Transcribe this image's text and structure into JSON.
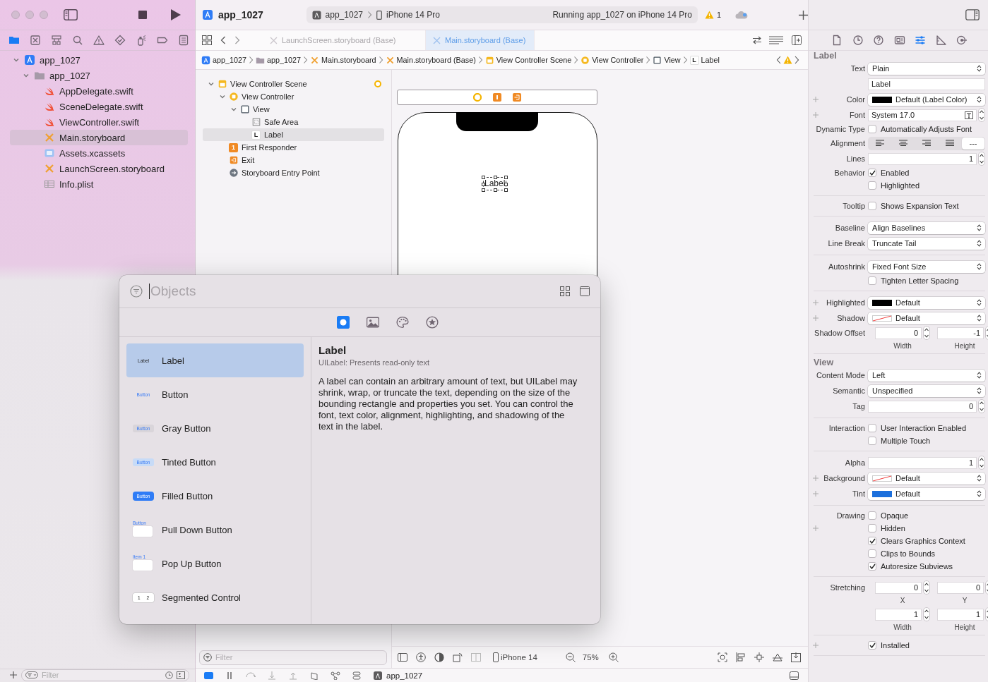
{
  "window": {
    "title": "app_1027"
  },
  "toolbar": {
    "scheme": "app_1027",
    "destination": "iPhone 14 Pro",
    "status": "Running app_1027 on iPhone 14 Pro",
    "warning_count": "1"
  },
  "navigator": {
    "tabs": [
      {
        "kind": "folder",
        "selected": true
      },
      {
        "kind": "source-control",
        "selected": false
      },
      {
        "kind": "hierarchy",
        "selected": false
      },
      {
        "kind": "search",
        "selected": false
      },
      {
        "kind": "warning",
        "selected": false
      },
      {
        "kind": "test",
        "selected": false
      },
      {
        "kind": "debug",
        "selected": false
      },
      {
        "kind": "breakpoint",
        "selected": false
      },
      {
        "kind": "report",
        "selected": false
      }
    ],
    "tree": [
      {
        "label": "app_1027",
        "kind": "project",
        "expanded": true,
        "selected": false,
        "children": [
          {
            "label": "app_1027",
            "kind": "folder",
            "expanded": true,
            "selected": false,
            "children": [
              {
                "label": "AppDelegate.swift",
                "kind": "swift",
                "selected": false
              },
              {
                "label": "SceneDelegate.swift",
                "kind": "swift",
                "selected": false
              },
              {
                "label": "ViewController.swift",
                "kind": "swift",
                "selected": false
              },
              {
                "label": "Main.storyboard",
                "kind": "storyboard",
                "selected": true
              },
              {
                "label": "Assets.xcassets",
                "kind": "assets",
                "selected": false
              },
              {
                "label": "LaunchScreen.storyboard",
                "kind": "storyboard",
                "selected": false
              },
              {
                "label": "Info.plist",
                "kind": "plist",
                "selected": false
              }
            ]
          }
        ]
      }
    ],
    "filter": {
      "placeholder": "Filter"
    }
  },
  "editor_tabs": [
    {
      "label": "LaunchScreen.storyboard (Base)",
      "selected": false
    },
    {
      "label": "Main.storyboard (Base)",
      "selected": true
    }
  ],
  "breadcrumb": [
    {
      "label": "app_1027",
      "kind": "project"
    },
    {
      "label": "app_1027",
      "kind": "folder"
    },
    {
      "label": "Main.storyboard",
      "kind": "storyboard"
    },
    {
      "label": "Main.storyboard (Base)",
      "kind": "storyboard"
    },
    {
      "label": "View Controller Scene",
      "kind": "scene"
    },
    {
      "label": "View Controller",
      "kind": "controller"
    },
    {
      "label": "View",
      "kind": "view"
    },
    {
      "label": "Label",
      "kind": "label",
      "glyph": "L"
    }
  ],
  "outline": {
    "tree": [
      {
        "label": "View Controller Scene",
        "kind": "scene",
        "expanded": true,
        "selected": false,
        "children": [
          {
            "label": "View Controller",
            "kind": "controller",
            "expanded": true,
            "selected": false,
            "children": [
              {
                "label": "View",
                "kind": "view",
                "expanded": true,
                "selected": false,
                "children": [
                  {
                    "label": "Safe Area",
                    "kind": "safearea",
                    "selected": false
                  },
                  {
                    "label": "Label",
                    "kind": "label",
                    "glyph": "L",
                    "selected": true
                  }
                ]
              }
            ]
          },
          {
            "label": "First Responder",
            "kind": "responder",
            "glyph": "1",
            "selected": false
          },
          {
            "label": "Exit",
            "kind": "exit",
            "selected": false
          },
          {
            "label": "Storyboard Entry Point",
            "kind": "entry",
            "selected": false
          }
        ]
      }
    ],
    "filter": {
      "placeholder": "Filter"
    }
  },
  "canvas": {
    "label": "Label"
  },
  "canvas_bar": {
    "device": "iPhone 14",
    "zoom": "75%"
  },
  "debug_bar": {
    "target": "app_1027"
  },
  "inspector": {
    "tabs": [
      {
        "kind": "file",
        "selected": false
      },
      {
        "kind": "history",
        "selected": false
      },
      {
        "kind": "help",
        "selected": false
      },
      {
        "kind": "identity",
        "selected": false
      },
      {
        "kind": "attributes",
        "selected": true
      },
      {
        "kind": "size",
        "selected": false
      },
      {
        "kind": "connections",
        "selected": false
      }
    ],
    "sections": [
      {
        "title": "Label",
        "rows": [
          {
            "kind": "popup",
            "label": "Text",
            "value": "Plain",
            "addable": false
          },
          {
            "kind": "field",
            "value": "Label",
            "addable": false
          },
          {
            "kind": "popup",
            "label": "Color",
            "value": "Default (Label Color)",
            "color": "#000000",
            "addable": true
          },
          {
            "kind": "font",
            "label": "Font",
            "value": "System 17.0",
            "addable": true
          },
          {
            "kind": "checkbox",
            "label": "Dynamic Type",
            "text": "Automatically Adjusts Font",
            "checked": false,
            "addable": false
          },
          {
            "kind": "alignment",
            "label": "Alignment",
            "addable": false,
            "segments": [
              {
                "kind": "left",
                "selected": false
              },
              {
                "kind": "center",
                "selected": false
              },
              {
                "kind": "right",
                "selected": false
              },
              {
                "kind": "justified",
                "selected": false
              },
              {
                "kind": "natural",
                "text": "---",
                "selected": true
              }
            ]
          },
          {
            "kind": "stepper",
            "label": "Lines",
            "value": "1",
            "addable": false
          },
          {
            "kind": "checkbox",
            "label": "Behavior",
            "text": "Enabled",
            "checked": true,
            "addable": false
          },
          {
            "kind": "checkbox",
            "text": "Highlighted",
            "checked": false,
            "addable": false
          },
          {
            "kind": "divider"
          },
          {
            "kind": "checkbox",
            "label": "Tooltip",
            "text": "Shows Expansion Text",
            "checked": false,
            "addable": false
          },
          {
            "kind": "divider"
          },
          {
            "kind": "popup",
            "label": "Baseline",
            "value": "Align Baselines",
            "addable": false
          },
          {
            "kind": "popup",
            "label": "Line Break",
            "value": "Truncate Tail",
            "addable": false
          },
          {
            "kind": "divider"
          },
          {
            "kind": "popup",
            "label": "Autoshrink",
            "value": "Fixed Font Size",
            "addable": false
          },
          {
            "kind": "checkbox",
            "text": "Tighten Letter Spacing",
            "checked": false,
            "addable": false
          },
          {
            "kind": "divider"
          },
          {
            "kind": "popup",
            "label": "Highlighted",
            "value": "Default",
            "color": "#000000",
            "addable": true
          },
          {
            "kind": "popup",
            "label": "Shadow",
            "value": "Default",
            "color_cleared": true,
            "addable": true
          },
          {
            "kind": "pair",
            "label": "Shadow Offset",
            "addable": false,
            "fields": [
              {
                "value": "0",
                "caption": "Width"
              },
              {
                "value": "-1",
                "caption": "Height"
              }
            ]
          },
          {
            "kind": "divider"
          }
        ]
      },
      {
        "title": "View",
        "rows": [
          {
            "kind": "popup",
            "label": "Content Mode",
            "value": "Left",
            "addable": false
          },
          {
            "kind": "popup",
            "label": "Semantic",
            "value": "Unspecified",
            "addable": false
          },
          {
            "kind": "stepper",
            "label": "Tag",
            "value": "0",
            "addable": false
          },
          {
            "kind": "divider"
          },
          {
            "kind": "checkbox",
            "label": "Interaction",
            "text": "User Interaction Enabled",
            "checked": false,
            "addable": false
          },
          {
            "kind": "checkbox",
            "text": "Multiple Touch",
            "checked": false,
            "addable": false
          },
          {
            "kind": "divider"
          },
          {
            "kind": "stepper",
            "label": "Alpha",
            "value": "1",
            "addable": false
          },
          {
            "kind": "popup",
            "label": "Background",
            "value": "Default",
            "color_cleared": true,
            "addable": true
          },
          {
            "kind": "popup",
            "label": "Tint",
            "value": "Default",
            "color": "#1b6fdc",
            "addable": true
          },
          {
            "kind": "divider"
          },
          {
            "kind": "checkbox",
            "label": "Drawing",
            "text": "Opaque",
            "checked": false,
            "addable": false
          },
          {
            "kind": "checkbox",
            "text": "Hidden",
            "checked": false,
            "addable": true
          },
          {
            "kind": "checkbox",
            "text": "Clears Graphics Context",
            "checked": true,
            "addable": false
          },
          {
            "kind": "checkbox",
            "text": "Clips to Bounds",
            "checked": false,
            "addable": false
          },
          {
            "kind": "checkbox",
            "text": "Autoresize Subviews",
            "checked": true,
            "addable": false
          },
          {
            "kind": "divider"
          },
          {
            "kind": "pair",
            "label": "Stretching",
            "addable": false,
            "fields": [
              {
                "value": "0",
                "caption": "X"
              },
              {
                "value": "0",
                "caption": "Y"
              }
            ]
          },
          {
            "kind": "pair",
            "addable": false,
            "fields": [
              {
                "value": "1",
                "caption": "Width"
              },
              {
                "value": "1",
                "caption": "Height"
              }
            ]
          },
          {
            "kind": "divider"
          },
          {
            "kind": "checkbox",
            "text": "Installed",
            "checked": true,
            "addable": true
          },
          {
            "kind": "divider"
          }
        ]
      }
    ]
  },
  "library": {
    "search": {
      "placeholder": "Objects"
    },
    "tabs": [
      {
        "kind": "objects",
        "selected": true
      },
      {
        "kind": "media",
        "selected": false
      },
      {
        "kind": "colors",
        "selected": false
      },
      {
        "kind": "snippets",
        "selected": false
      }
    ],
    "items": [
      {
        "name": "Label",
        "kind": "label",
        "preview": "Label",
        "selected": true
      },
      {
        "name": "Button",
        "kind": "plain",
        "preview": "Button",
        "selected": false
      },
      {
        "name": "Gray Button",
        "kind": "gray",
        "preview": "Button",
        "selected": false
      },
      {
        "name": "Tinted Button",
        "kind": "tinted",
        "preview": "Button",
        "selected": false
      },
      {
        "name": "Filled Button",
        "kind": "filled",
        "preview": "Button",
        "selected": false
      },
      {
        "name": "Pull Down Button",
        "kind": "pulldown",
        "preview": "Button",
        "selected": false
      },
      {
        "name": "Pop Up Button",
        "kind": "popup",
        "preview": "Item 1",
        "selected": false
      },
      {
        "name": "Segmented Control",
        "kind": "segmented",
        "preview": "1 2",
        "selected": false
      }
    ],
    "detail": {
      "title": "Label",
      "subtitle": "UILabel: Presents read-only text",
      "description": "A label can contain an arbitrary amount of text, but UILabel may shrink, wrap, or truncate the text, depending on the size of the bounding rectangle and properties you set. You can control the font, text color, alignment, highlighting, and shadowing of the text in the label."
    }
  }
}
